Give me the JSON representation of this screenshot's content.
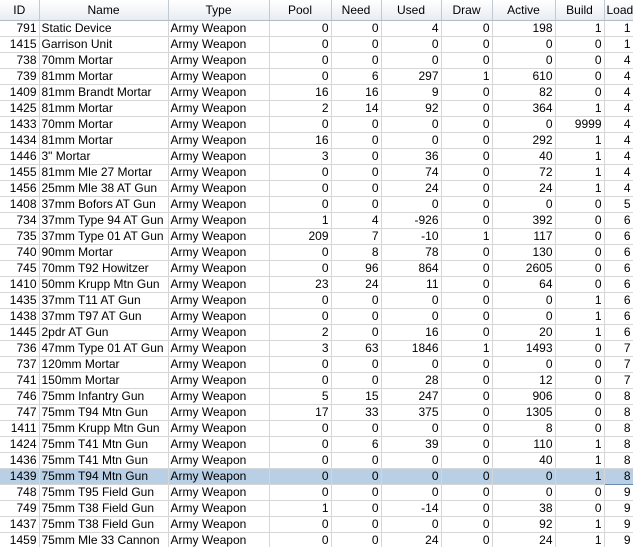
{
  "columns": [
    {
      "key": "id",
      "label": "ID"
    },
    {
      "key": "name",
      "label": "Name"
    },
    {
      "key": "type",
      "label": "Type"
    },
    {
      "key": "pool",
      "label": "Pool"
    },
    {
      "key": "need",
      "label": "Need"
    },
    {
      "key": "used",
      "label": "Used"
    },
    {
      "key": "draw",
      "label": "Draw"
    },
    {
      "key": "active",
      "label": "Active"
    },
    {
      "key": "build",
      "label": "Build"
    },
    {
      "key": "load",
      "label": "Load"
    }
  ],
  "sort": {
    "column": "load",
    "direction": "descending",
    "icon": "sort-descending-icon"
  },
  "selected_row_id": "1439",
  "colors": {
    "selection": "#b8cfe5",
    "grid": "#d6d6d6",
    "header_border": "#c3c9d1"
  },
  "rows": [
    {
      "id": "791",
      "name": "Static Device",
      "type": "Army Weapon",
      "pool": "0",
      "need": "0",
      "used": "4",
      "draw": "0",
      "active": "198",
      "build": "1",
      "load": "1"
    },
    {
      "id": "1415",
      "name": "Garrison Unit",
      "type": "Army Weapon",
      "pool": "0",
      "need": "0",
      "used": "0",
      "draw": "0",
      "active": "0",
      "build": "0",
      "load": "1"
    },
    {
      "id": "738",
      "name": "70mm Mortar",
      "type": "Army Weapon",
      "pool": "0",
      "need": "0",
      "used": "0",
      "draw": "0",
      "active": "0",
      "build": "0",
      "load": "4"
    },
    {
      "id": "739",
      "name": "81mm Mortar",
      "type": "Army Weapon",
      "pool": "0",
      "need": "6",
      "used": "297",
      "draw": "1",
      "active": "610",
      "build": "0",
      "load": "4"
    },
    {
      "id": "1409",
      "name": "81mm Brandt Mortar",
      "type": "Army Weapon",
      "pool": "16",
      "need": "16",
      "used": "9",
      "draw": "0",
      "active": "82",
      "build": "0",
      "load": "4"
    },
    {
      "id": "1425",
      "name": "81mm Mortar",
      "type": "Army Weapon",
      "pool": "2",
      "need": "14",
      "used": "92",
      "draw": "0",
      "active": "364",
      "build": "1",
      "load": "4"
    },
    {
      "id": "1433",
      "name": "70mm Mortar",
      "type": "Army Weapon",
      "pool": "0",
      "need": "0",
      "used": "0",
      "draw": "0",
      "active": "0",
      "build": "9999",
      "load": "4"
    },
    {
      "id": "1434",
      "name": "81mm Mortar",
      "type": "Army Weapon",
      "pool": "16",
      "need": "0",
      "used": "0",
      "draw": "0",
      "active": "292",
      "build": "1",
      "load": "4"
    },
    {
      "id": "1446",
      "name": "3\" Mortar",
      "type": "Army Weapon",
      "pool": "3",
      "need": "0",
      "used": "36",
      "draw": "0",
      "active": "40",
      "build": "1",
      "load": "4"
    },
    {
      "id": "1455",
      "name": "81mm Mle 27 Mortar",
      "type": "Army Weapon",
      "pool": "0",
      "need": "0",
      "used": "74",
      "draw": "0",
      "active": "72",
      "build": "1",
      "load": "4"
    },
    {
      "id": "1456",
      "name": "25mm Mle 38 AT Gun",
      "type": "Army Weapon",
      "pool": "0",
      "need": "0",
      "used": "24",
      "draw": "0",
      "active": "24",
      "build": "1",
      "load": "4"
    },
    {
      "id": "1408",
      "name": "37mm Bofors AT Gun",
      "type": "Army Weapon",
      "pool": "0",
      "need": "0",
      "used": "0",
      "draw": "0",
      "active": "0",
      "build": "0",
      "load": "5"
    },
    {
      "id": "734",
      "name": "37mm Type 94 AT Gun",
      "type": "Army Weapon",
      "pool": "1",
      "need": "4",
      "used": "-926",
      "draw": "0",
      "active": "392",
      "build": "0",
      "load": "6"
    },
    {
      "id": "735",
      "name": "37mm Type 01 AT Gun",
      "type": "Army Weapon",
      "pool": "209",
      "need": "7",
      "used": "-10",
      "draw": "1",
      "active": "117",
      "build": "0",
      "load": "6"
    },
    {
      "id": "740",
      "name": "90mm Mortar",
      "type": "Army Weapon",
      "pool": "0",
      "need": "8",
      "used": "78",
      "draw": "0",
      "active": "130",
      "build": "0",
      "load": "6"
    },
    {
      "id": "745",
      "name": "70mm T92 Howitzer",
      "type": "Army Weapon",
      "pool": "0",
      "need": "96",
      "used": "864",
      "draw": "0",
      "active": "2605",
      "build": "0",
      "load": "6"
    },
    {
      "id": "1410",
      "name": "50mm Krupp Mtn Gun",
      "type": "Army Weapon",
      "pool": "23",
      "need": "24",
      "used": "11",
      "draw": "0",
      "active": "64",
      "build": "0",
      "load": "6"
    },
    {
      "id": "1435",
      "name": "37mm T11 AT Gun",
      "type": "Army Weapon",
      "pool": "0",
      "need": "0",
      "used": "0",
      "draw": "0",
      "active": "0",
      "build": "1",
      "load": "6"
    },
    {
      "id": "1438",
      "name": "37mm T97 AT Gun",
      "type": "Army Weapon",
      "pool": "0",
      "need": "0",
      "used": "0",
      "draw": "0",
      "active": "0",
      "build": "1",
      "load": "6"
    },
    {
      "id": "1445",
      "name": "2pdr AT Gun",
      "type": "Army Weapon",
      "pool": "2",
      "need": "0",
      "used": "16",
      "draw": "0",
      "active": "20",
      "build": "1",
      "load": "6"
    },
    {
      "id": "736",
      "name": "47mm Type 01 AT Gun",
      "type": "Army Weapon",
      "pool": "3",
      "need": "63",
      "used": "1846",
      "draw": "1",
      "active": "1493",
      "build": "0",
      "load": "7"
    },
    {
      "id": "737",
      "name": "120mm Mortar",
      "type": "Army Weapon",
      "pool": "0",
      "need": "0",
      "used": "0",
      "draw": "0",
      "active": "0",
      "build": "0",
      "load": "7"
    },
    {
      "id": "741",
      "name": "150mm Mortar",
      "type": "Army Weapon",
      "pool": "0",
      "need": "0",
      "used": "28",
      "draw": "0",
      "active": "12",
      "build": "0",
      "load": "7"
    },
    {
      "id": "746",
      "name": "75mm Infantry Gun",
      "type": "Army Weapon",
      "pool": "5",
      "need": "15",
      "used": "247",
      "draw": "0",
      "active": "906",
      "build": "0",
      "load": "8"
    },
    {
      "id": "747",
      "name": "75mm T94 Mtn Gun",
      "type": "Army Weapon",
      "pool": "17",
      "need": "33",
      "used": "375",
      "draw": "0",
      "active": "1305",
      "build": "0",
      "load": "8"
    },
    {
      "id": "1411",
      "name": "75mm Krupp Mtn Gun",
      "type": "Army Weapon",
      "pool": "0",
      "need": "0",
      "used": "0",
      "draw": "0",
      "active": "8",
      "build": "0",
      "load": "8"
    },
    {
      "id": "1424",
      "name": "75mm T41 Mtn Gun",
      "type": "Army Weapon",
      "pool": "0",
      "need": "6",
      "used": "39",
      "draw": "0",
      "active": "110",
      "build": "1",
      "load": "8"
    },
    {
      "id": "1436",
      "name": "75mm T41 Mtn Gun",
      "type": "Army Weapon",
      "pool": "0",
      "need": "0",
      "used": "0",
      "draw": "0",
      "active": "40",
      "build": "1",
      "load": "8"
    },
    {
      "id": "1439",
      "name": "75mm T94 Mtn Gun",
      "type": "Army Weapon",
      "pool": "0",
      "need": "0",
      "used": "0",
      "draw": "0",
      "active": "0",
      "build": "1",
      "load": "8"
    },
    {
      "id": "748",
      "name": "75mm T95 Field Gun",
      "type": "Army Weapon",
      "pool": "0",
      "need": "0",
      "used": "0",
      "draw": "0",
      "active": "0",
      "build": "0",
      "load": "9"
    },
    {
      "id": "749",
      "name": "75mm T38 Field Gun",
      "type": "Army Weapon",
      "pool": "1",
      "need": "0",
      "used": "-14",
      "draw": "0",
      "active": "38",
      "build": "0",
      "load": "9"
    },
    {
      "id": "1437",
      "name": "75mm T38 Field Gun",
      "type": "Army Weapon",
      "pool": "0",
      "need": "0",
      "used": "0",
      "draw": "0",
      "active": "92",
      "build": "1",
      "load": "9"
    },
    {
      "id": "1459",
      "name": "75mm Mle 33 Cannon",
      "type": "Army Weapon",
      "pool": "0",
      "need": "0",
      "used": "24",
      "draw": "0",
      "active": "24",
      "build": "1",
      "load": "9"
    }
  ]
}
